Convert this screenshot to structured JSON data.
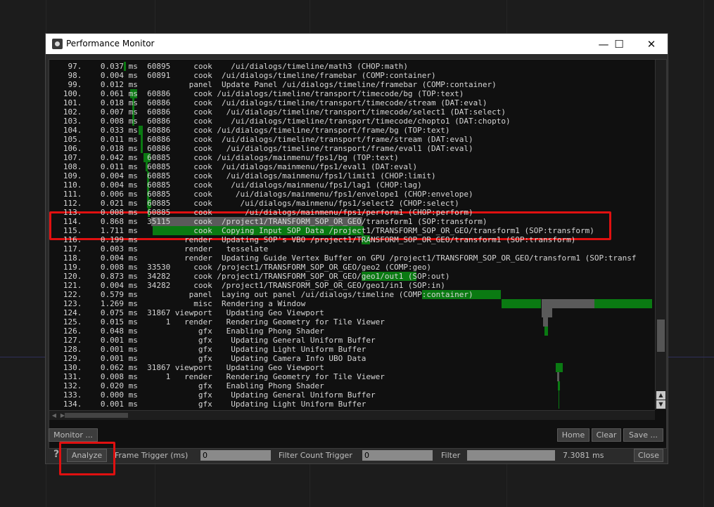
{
  "window": {
    "title": "Performance Monitor",
    "controls": {
      "minimize": "—",
      "maximize": "☐",
      "close": "✕"
    }
  },
  "log": {
    "rows": [
      {
        "n": "97.",
        "t": "0.037 ms",
        "frame": "60895",
        "type": "cook",
        "path": "    /ui/dialogs/timeline/math3 (CHOP:math)"
      },
      {
        "n": "98.",
        "t": "0.004 ms",
        "frame": "60891",
        "type": "cook",
        "path": "  /ui/dialogs/timeline/framebar (COMP:container)"
      },
      {
        "n": "99.",
        "t": "0.012 ms",
        "frame": "",
        "type": "panel",
        "path": "  Update Panel /ui/dialogs/timeline/framebar (COMP:container)"
      },
      {
        "n": "100.",
        "t": "0.061 ms",
        "frame": "60886",
        "type": "cook",
        "path": " /ui/dialogs/timeline/transport/timecode/bg (TOP:text)"
      },
      {
        "n": "101.",
        "t": "0.018 ms",
        "frame": "60886",
        "type": "cook",
        "path": "  /ui/dialogs/timeline/transport/timecode/stream (DAT:eval)"
      },
      {
        "n": "102.",
        "t": "0.007 ms",
        "frame": "60886",
        "type": "cook",
        "path": "   /ui/dialogs/timeline/transport/timecode/select1 (DAT:select)"
      },
      {
        "n": "103.",
        "t": "0.008 ms",
        "frame": "60886",
        "type": "cook",
        "path": "    /ui/dialogs/timeline/transport/timecode/chopto1 (DAT:chopto)"
      },
      {
        "n": "104.",
        "t": "0.033 ms",
        "frame": "60886",
        "type": "cook",
        "path": " /ui/dialogs/timeline/transport/frame/bg (TOP:text)"
      },
      {
        "n": "105.",
        "t": "0.011 ms",
        "frame": "60886",
        "type": "cook",
        "path": "  /ui/dialogs/timeline/transport/frame/stream (DAT:eval)"
      },
      {
        "n": "106.",
        "t": "0.018 ms",
        "frame": "60886",
        "type": "cook",
        "path": "   /ui/dialogs/timeline/transport/frame/eval1 (DAT:eval)"
      },
      {
        "n": "107.",
        "t": "0.042 ms",
        "frame": "60885",
        "type": "cook",
        "path": " /ui/dialogs/mainmenu/fps1/bg (TOP:text)"
      },
      {
        "n": "108.",
        "t": "0.011 ms",
        "frame": "60885",
        "type": "cook",
        "path": "  /ui/dialogs/mainmenu/fps1/eval1 (DAT:eval)"
      },
      {
        "n": "109.",
        "t": "0.004 ms",
        "frame": "60885",
        "type": "cook",
        "path": "   /ui/dialogs/mainmenu/fps1/limit1 (CHOP:limit)"
      },
      {
        "n": "110.",
        "t": "0.004 ms",
        "frame": "60885",
        "type": "cook",
        "path": "    /ui/dialogs/mainmenu/fps1/lag1 (CHOP:lag)"
      },
      {
        "n": "111.",
        "t": "0.006 ms",
        "frame": "60885",
        "type": "cook",
        "path": "     /ui/dialogs/mainmenu/fps1/envelope1 (CHOP:envelope)"
      },
      {
        "n": "112.",
        "t": "0.021 ms",
        "frame": "60885",
        "type": "cook",
        "path": "      /ui/dialogs/mainmenu/fps1/select2 (CHOP:select)"
      },
      {
        "n": "113.",
        "t": "0.008 ms",
        "frame": "60885",
        "type": "cook",
        "path": "       /ui/dialogs/mainmenu/fps1/perform1 (CHOP:perform)"
      },
      {
        "n": "114.",
        "t": "0.868 ms",
        "frame": "35115",
        "type": "cook",
        "path": "  /project1/TRANSFORM_SOP_OR_GEO/transform1 (SOP:transform)"
      },
      {
        "n": "115.",
        "t": "1.711 ms",
        "frame": "",
        "type": "cook",
        "path": "  Copying Input SOP Data /project1/TRANSFORM_SOP_OR_GEO/transform1 (SOP:transform)"
      },
      {
        "n": "116.",
        "t": "0.199 ms",
        "frame": "",
        "type": "render",
        "path": "  Updating SOP's VBO /project1/TRANSFORM_SOP_OR_GEO/transform1 (SOP:transform)"
      },
      {
        "n": "117.",
        "t": "0.003 ms",
        "frame": "",
        "type": "render",
        "path": "   tesselate"
      },
      {
        "n": "118.",
        "t": "0.004 ms",
        "frame": "",
        "type": "render",
        "path": "  Updating Guide Vertex Buffer on GPU /project1/TRANSFORM_SOP_OR_GEO/transform1 (SOP:transf"
      },
      {
        "n": "119.",
        "t": "0.008 ms",
        "frame": "33530",
        "type": "cook",
        "path": " /project1/TRANSFORM_SOP_OR_GEO/geo2 (COMP:geo)"
      },
      {
        "n": "120.",
        "t": "0.873 ms",
        "frame": "34282",
        "type": "cook",
        "path": " /project1/TRANSFORM_SOP_OR_GEO/geo1/out1 (SOP:out)"
      },
      {
        "n": "121.",
        "t": "0.004 ms",
        "frame": "34282",
        "type": "cook",
        "path": "  /project1/TRANSFORM_SOP_OR_GEO/geo1/in1 (SOP:in)"
      },
      {
        "n": "122.",
        "t": "0.579 ms",
        "frame": "",
        "type": "panel",
        "path": "  Laying out panel /ui/dialogs/timeline (COMP:container)"
      },
      {
        "n": "123.",
        "t": "1.269 ms",
        "frame": "",
        "type": "misc",
        "path": "  Rendering a Window"
      },
      {
        "n": "124.",
        "t": "0.075 ms",
        "frame": "31867",
        "type": "viewport",
        "path": "   Updating Geo Viewport"
      },
      {
        "n": "125.",
        "t": "0.015 ms",
        "frame": "1",
        "type": "render",
        "path": "   Rendering Geometry for Tile Viewer"
      },
      {
        "n": "126.",
        "t": "0.048 ms",
        "frame": "",
        "type": "gfx",
        "path": "   Enabling Phong Shader"
      },
      {
        "n": "127.",
        "t": "0.001 ms",
        "frame": "",
        "type": "gfx",
        "path": "    Updating General Uniform Buffer"
      },
      {
        "n": "128.",
        "t": "0.001 ms",
        "frame": "",
        "type": "gfx",
        "path": "    Updating Light Uniform Buffer"
      },
      {
        "n": "129.",
        "t": "0.001 ms",
        "frame": "",
        "type": "gfx",
        "path": "    Updating Camera Info UBO Data"
      },
      {
        "n": "130.",
        "t": "0.062 ms",
        "frame": "31867",
        "type": "viewport",
        "path": "   Updating Geo Viewport"
      },
      {
        "n": "131.",
        "t": "0.008 ms",
        "frame": "1",
        "type": "render",
        "path": "   Rendering Geometry for Tile Viewer"
      },
      {
        "n": "132.",
        "t": "0.020 ms",
        "frame": "",
        "type": "gfx",
        "path": "   Enabling Phong Shader"
      },
      {
        "n": "133.",
        "t": "0.000 ms",
        "frame": "",
        "type": "gfx",
        "path": "    Updating General Uniform Buffer"
      },
      {
        "n": "134.",
        "t": "0.001 ms",
        "frame": "",
        "type": "gfx",
        "path": "    Updating Light Uniform Buffer"
      }
    ]
  },
  "buttons": {
    "monitor": "Monitor ...",
    "home": "Home",
    "clear": "Clear",
    "save": "Save ...",
    "analyze": "Analyze",
    "close": "Close"
  },
  "controls": {
    "frame_trigger_label": "Frame Trigger (ms)",
    "frame_trigger_value": "0",
    "filter_count_label": "Filter Count Trigger",
    "filter_count_value": "0",
    "filter_label": "Filter",
    "filter_value": "",
    "total_time": "7.3081 ms",
    "help_glyph": "?"
  },
  "colors": {
    "accent_green": "#0a7a12",
    "highlight_red": "#e01010",
    "background": "#101010"
  }
}
